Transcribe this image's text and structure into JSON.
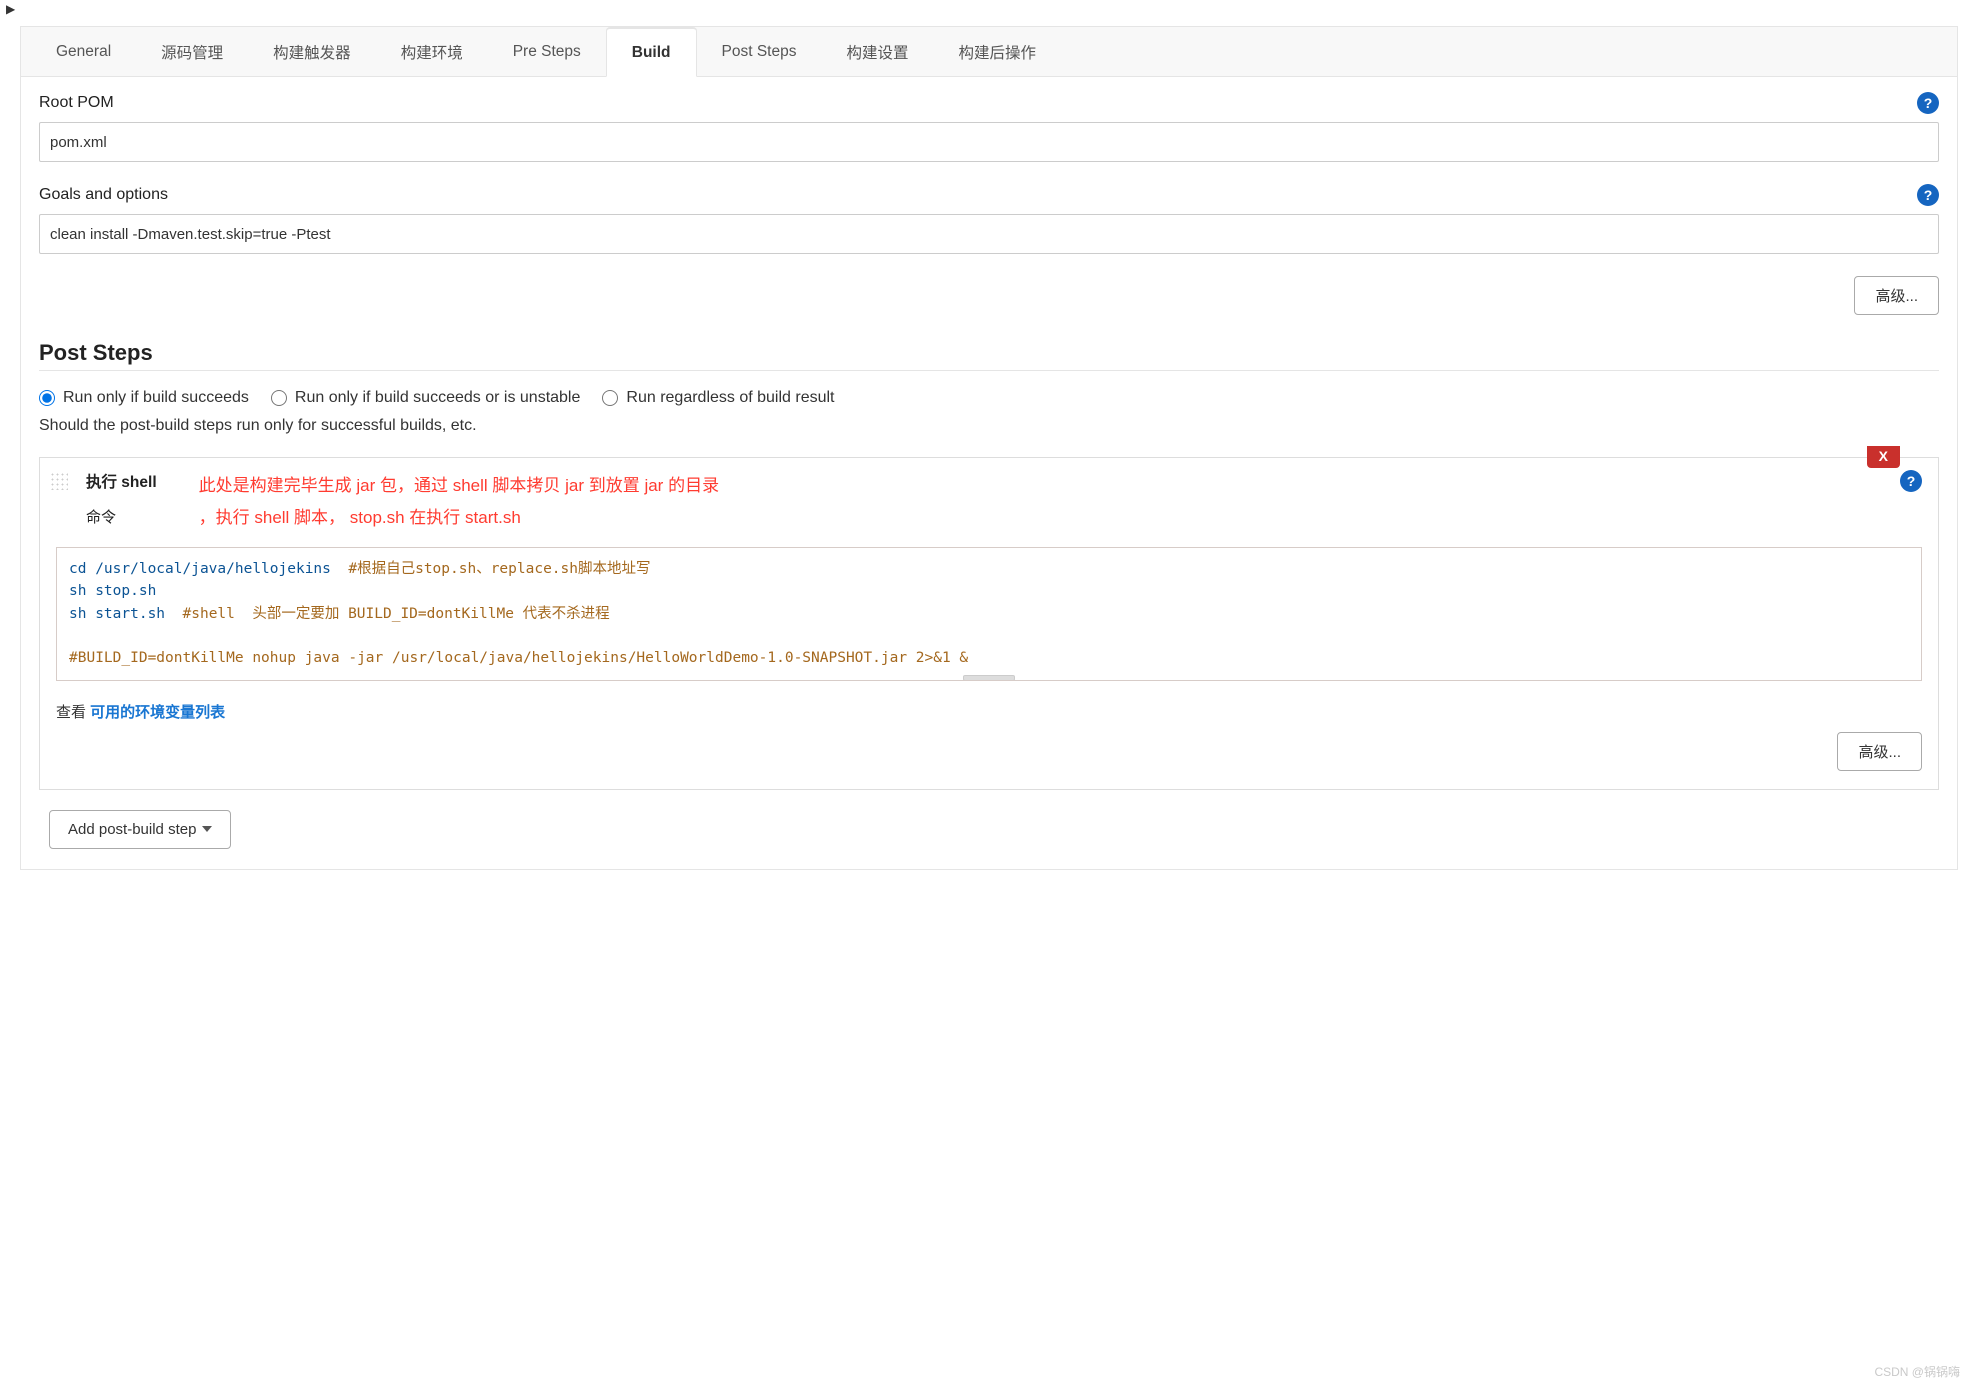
{
  "tabs": {
    "general": "General",
    "scm": "源码管理",
    "triggers": "构建触发器",
    "env": "构建环境",
    "presteps": "Pre Steps",
    "build": "Build",
    "poststeps_tab": "Post Steps",
    "settings": "构建设置",
    "postactions": "构建后操作"
  },
  "build": {
    "rootpom_label": "Root POM",
    "rootpom_value": "pom.xml",
    "goals_label": "Goals and options",
    "goals_value": "clean install -Dmaven.test.skip=true -Ptest",
    "advanced": "高级..."
  },
  "poststeps": {
    "title": "Post Steps",
    "radio_success": "Run only if build succeeds",
    "radio_unstable": "Run only if build succeeds or is unstable",
    "radio_regardless": "Run regardless of build result",
    "hint": "Should the post-build steps run only for successful builds, etc.",
    "shell_title": "执行 shell",
    "cmd_label": "命令",
    "delete_label": "X",
    "annotation_line1": "此处是构建完毕生成 jar 包，通过 shell 脚本拷贝 jar 到放置 jar 的目录",
    "annotation_line2": "，执行 shell 脚本， stop.sh  在执行 start.sh",
    "code": {
      "l1a": "cd /usr/local/java/hellojekins  ",
      "l1b": "#根据自己stop.sh、replace.sh脚本地址写",
      "l2": "sh stop.sh",
      "l3a": "sh start.sh  ",
      "l3b": "#shell  头部一定要加 BUILD_ID=dontKillMe 代表不杀进程",
      "l4": "#BUILD_ID=dontKillMe nohup java -jar /usr/local/java/hellojekins/HelloWorldDemo-1.0-SNAPSHOT.jar 2>&1 &"
    },
    "see_label": "查看 ",
    "see_link": "可用的环境变量列表",
    "advanced": "高级...",
    "add_step": "Add post-build step"
  },
  "help_symbol": "?",
  "watermark": "CSDN @锅锅嗨"
}
